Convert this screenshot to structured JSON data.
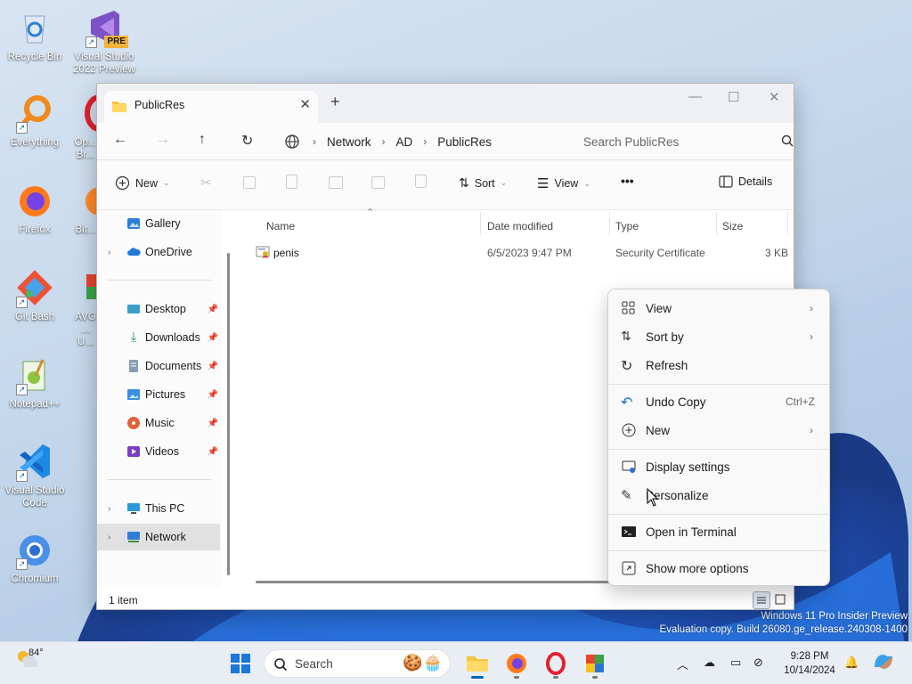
{
  "desktop": {
    "icons": [
      {
        "label": "Recycle Bin"
      },
      {
        "label": "Visual Studio 2022 Preview",
        "badge": "PRE"
      },
      {
        "label": "Everything"
      },
      {
        "label": "Op... Br..."
      },
      {
        "label": "Firefox"
      },
      {
        "label": "Bit..."
      },
      {
        "label": "Git Bash"
      },
      {
        "label": "AVG ... U..."
      },
      {
        "label": "Notepad++"
      },
      {
        "label": "Visual Studio Code"
      },
      {
        "label": "Chromium"
      }
    ],
    "watermark_line1": "Windows 11 Pro Insider Preview",
    "watermark_line2": "Evaluation copy. Build 26080.ge_release.240308-1400"
  },
  "explorer": {
    "tab_title": "PublicRes",
    "breadcrumb": [
      "Network",
      "AD",
      "PublicRes"
    ],
    "search_placeholder": "Search PublicRes",
    "commands": {
      "new": "New",
      "sort": "Sort",
      "view": "View",
      "more": "•••",
      "details": "Details"
    },
    "nav": {
      "gallery": "Gallery",
      "onedrive": "OneDrive",
      "desktop": "Desktop",
      "downloads": "Downloads",
      "documents": "Documents",
      "pictures": "Pictures",
      "music": "Music",
      "videos": "Videos",
      "thispc": "This PC",
      "network": "Network"
    },
    "columns": {
      "name": "Name",
      "date": "Date modified",
      "type": "Type",
      "size": "Size"
    },
    "files": [
      {
        "name": "penis",
        "date": "6/5/2023 9:47 PM",
        "type": "Security Certificate",
        "size": "3 KB"
      }
    ],
    "status": "1 item"
  },
  "context_menu": {
    "view": "View",
    "sort_by": "Sort by",
    "refresh": "Refresh",
    "undo_copy": "Undo Copy",
    "undo_shortcut": "Ctrl+Z",
    "new": "New",
    "display_settings": "Display settings",
    "personalize": "Personalize",
    "open_terminal": "Open in Terminal",
    "show_more": "Show more options"
  },
  "taskbar": {
    "weather_temp": "84°",
    "search": "Search",
    "time": "9:28 PM",
    "date": "10/14/2024"
  },
  "colors": {
    "accent": "#0067c0",
    "folder": "#f4c542",
    "network": "#2f7ed8"
  }
}
